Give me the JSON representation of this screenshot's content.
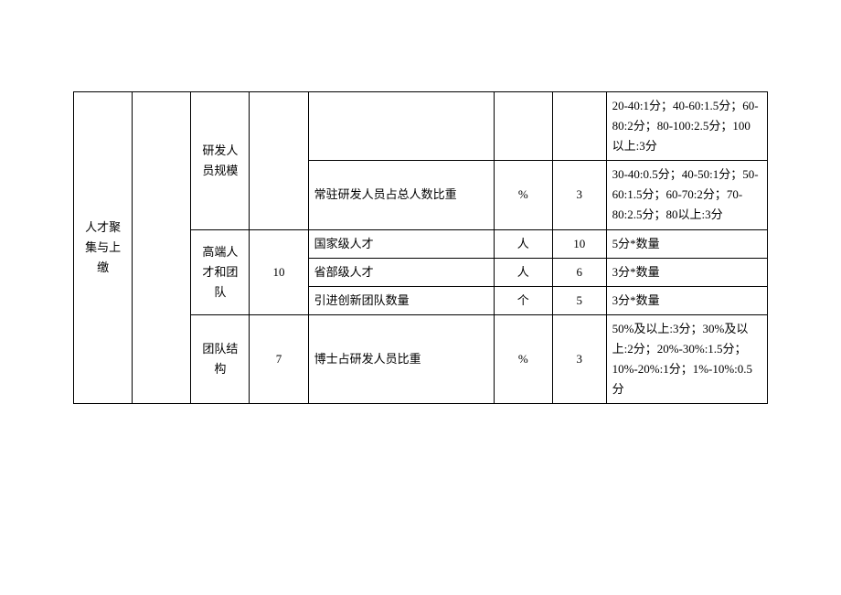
{
  "col0": "人才聚集与上缴",
  "rows": [
    {
      "sub": "研发人员规模",
      "subScore": "",
      "metric": "",
      "unit": "",
      "score": "",
      "desc": "20-40:1分；40-60:1.5分；60-80:2分；80-100:2.5分；100以上:3分"
    },
    {
      "metric": "常驻研发人员占总人数比重",
      "unit": "%",
      "score": "3",
      "desc": "30-40:0.5分；40-50:1分；50-60:1.5分；60-70:2分；70-80:2.5分；80以上:3分"
    },
    {
      "sub": "高端人才和团队",
      "subScore": "10",
      "metric": "国家级人才",
      "unit": "人",
      "score": "10",
      "desc": "5分*数量"
    },
    {
      "metric": "省部级人才",
      "unit": "人",
      "score": "6",
      "desc": "3分*数量"
    },
    {
      "metric": "引进创新团队数量",
      "unit": "个",
      "score": "5",
      "desc": "3分*数量"
    },
    {
      "sub": "团队结构",
      "subScore": "7",
      "metric": "博士占研发人员比重",
      "unit": "%",
      "score": "3",
      "desc": "50%及以上:3分；30%及以上:2分；20%-30%:1.5分；10%-20%:1分；1%-10%:0.5分"
    }
  ]
}
